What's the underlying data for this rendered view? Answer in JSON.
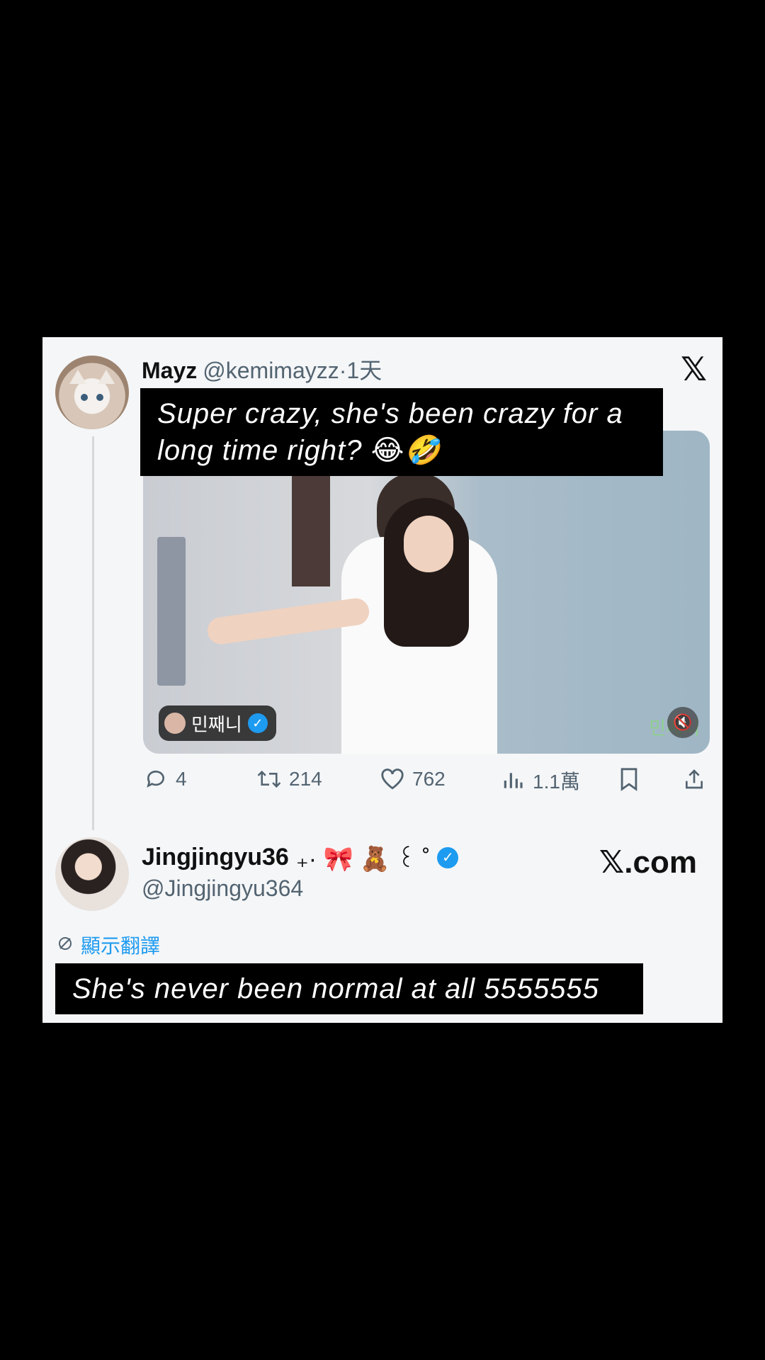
{
  "tweet1": {
    "display_name": "Mayz",
    "handle": "@kemimayzz",
    "time": "·1天",
    "caption": "Super crazy, she's been crazy for a long time right? 😂🤣",
    "media": {
      "channel_name": "민째니",
      "watermark": "민째니"
    },
    "actions": {
      "replies": "4",
      "retweets": "214",
      "likes": "762",
      "views": "1.1萬"
    }
  },
  "brand_logo": "𝕏",
  "tweet2": {
    "display_name": "Jingjingyu36",
    "decorations": "₊· 🎀 🧸 ꒰ ˚",
    "handle": "@Jingjingyu364",
    "source_label": "𝕏.com",
    "translate_label": "顯示翻譯",
    "caption": "She's never been normal at all 5555555"
  },
  "icons": {
    "reply": "reply-icon",
    "retweet": "retweet-icon",
    "like": "heart-icon",
    "views": "views-icon",
    "bookmark": "bookmark-icon",
    "share": "share-icon"
  },
  "colors": {
    "background": "#000000",
    "card": "#f5f6f8",
    "accent": "#1d9bf0",
    "muted_text": "#536471"
  }
}
